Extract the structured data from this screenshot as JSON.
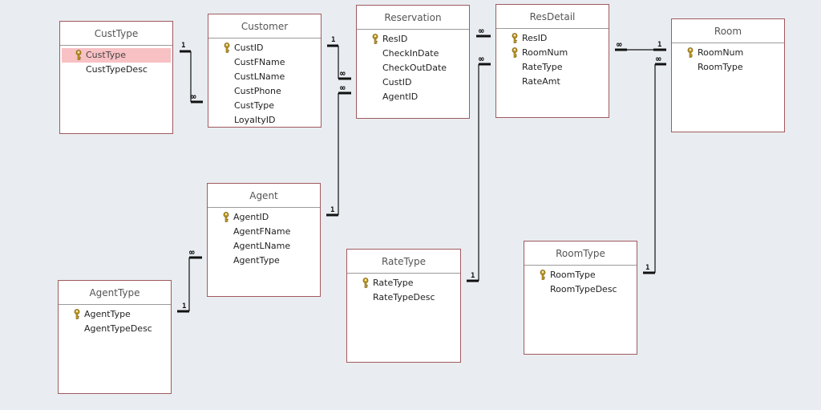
{
  "tables": {
    "custtype": {
      "title": "CustType",
      "fields": [
        {
          "name": "CustType",
          "key": true,
          "selected": true
        },
        {
          "name": "CustTypeDesc",
          "key": false
        }
      ]
    },
    "customer": {
      "title": "Customer",
      "fields": [
        {
          "name": "CustID",
          "key": true
        },
        {
          "name": "CustFName",
          "key": false
        },
        {
          "name": "CustLName",
          "key": false
        },
        {
          "name": "CustPhone",
          "key": false
        },
        {
          "name": "CustType",
          "key": false
        },
        {
          "name": "LoyaltyID",
          "key": false
        }
      ]
    },
    "reservation": {
      "title": "Reservation",
      "fields": [
        {
          "name": "ResID",
          "key": true
        },
        {
          "name": "CheckInDate",
          "key": false
        },
        {
          "name": "CheckOutDate",
          "key": false
        },
        {
          "name": "CustID",
          "key": false
        },
        {
          "name": "AgentID",
          "key": false
        }
      ]
    },
    "resdetail": {
      "title": "ResDetail",
      "fields": [
        {
          "name": "ResID",
          "key": true
        },
        {
          "name": "RoomNum",
          "key": true
        },
        {
          "name": "RateType",
          "key": false
        },
        {
          "name": "RateAmt",
          "key": false
        }
      ]
    },
    "room": {
      "title": "Room",
      "fields": [
        {
          "name": "RoomNum",
          "key": true
        },
        {
          "name": "RoomType",
          "key": false
        }
      ]
    },
    "agent": {
      "title": "Agent",
      "fields": [
        {
          "name": "AgentID",
          "key": true
        },
        {
          "name": "AgentFName",
          "key": false
        },
        {
          "name": "AgentLName",
          "key": false
        },
        {
          "name": "AgentType",
          "key": false
        }
      ]
    },
    "agenttype": {
      "title": "AgentType",
      "fields": [
        {
          "name": "AgentType",
          "key": true
        },
        {
          "name": "AgentTypeDesc",
          "key": false
        }
      ]
    },
    "ratetype": {
      "title": "RateType",
      "fields": [
        {
          "name": "RateType",
          "key": true
        },
        {
          "name": "RateTypeDesc",
          "key": false
        }
      ]
    },
    "roomtype": {
      "title": "RoomType",
      "fields": [
        {
          "name": "RoomType",
          "key": true
        },
        {
          "name": "RoomTypeDesc",
          "key": false
        }
      ]
    }
  },
  "relationships": [
    {
      "from": "CustType.CustType",
      "to": "Customer.CustType",
      "one": "1",
      "many": "∞"
    },
    {
      "from": "Customer.CustID",
      "to": "Reservation.CustID",
      "one": "1",
      "many": "∞"
    },
    {
      "from": "Agent.AgentID",
      "to": "Reservation.AgentID",
      "one": "1",
      "many": "∞"
    },
    {
      "from": "AgentType.AgentType",
      "to": "Agent.AgentType",
      "one": "1",
      "many": "∞"
    },
    {
      "from": "Reservation.ResID",
      "to": "ResDetail.ResID",
      "one": "1",
      "many": "∞"
    },
    {
      "from": "RateType.RateType",
      "to": "ResDetail.RateType",
      "one": "1",
      "many": "∞"
    },
    {
      "from": "Room.RoomNum",
      "to": "ResDetail.RoomNum",
      "one": "1",
      "many": "∞"
    },
    {
      "from": "RoomType.RoomType",
      "to": "Room.RoomType",
      "one": "1",
      "many": "∞"
    }
  ],
  "labels": {
    "one": "1",
    "many": "∞"
  },
  "colors": {
    "background": "#e9edf1",
    "table_border": "#a05a5e",
    "selected_row": "#f8c1c4",
    "key_icon": "#c9a227"
  }
}
